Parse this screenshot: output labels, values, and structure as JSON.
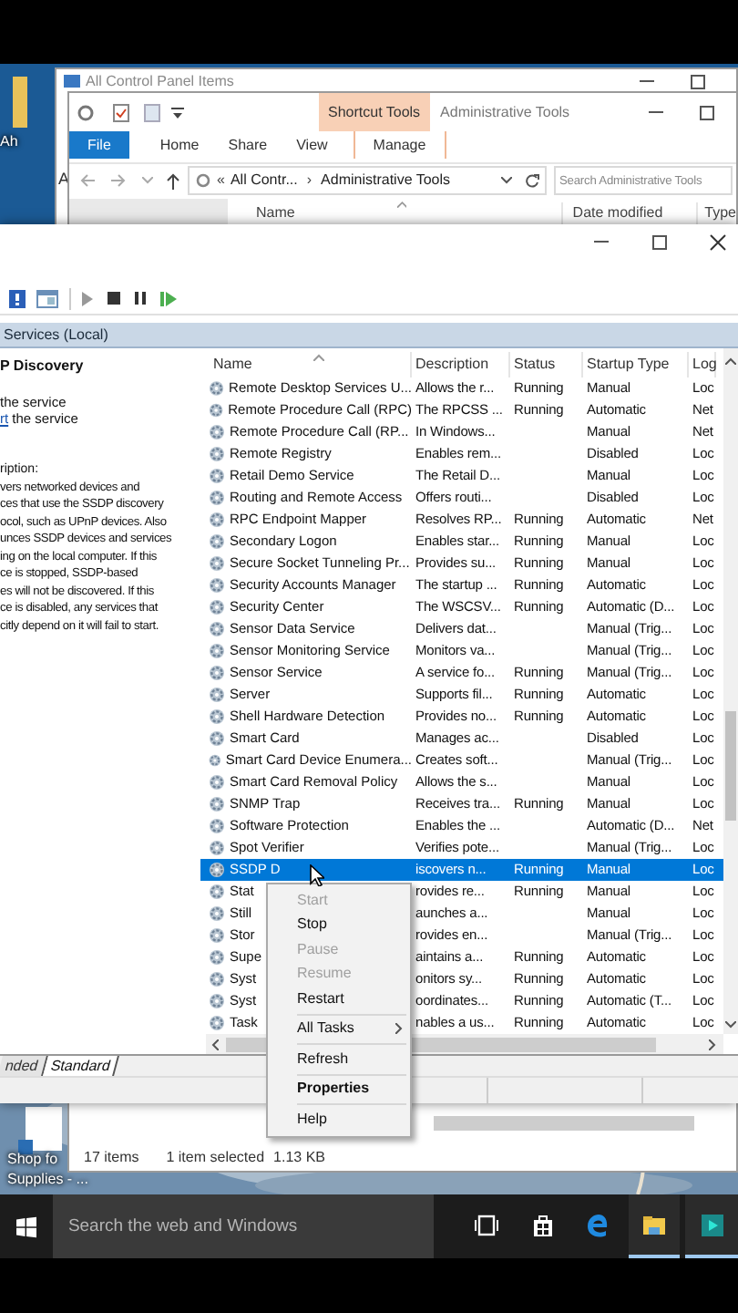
{
  "desktop": {
    "icons": [
      {
        "kind": "folder",
        "lines": [
          "Ah"
        ]
      },
      {
        "kind": "document",
        "lines": [
          "Shop fo",
          "Supplies - ..."
        ]
      }
    ]
  },
  "control_panel_window": {
    "title": "All Control Panel Items",
    "fragment": "A"
  },
  "explorer_window": {
    "contextual_tab": "Shortcut Tools",
    "title": "Administrative Tools",
    "ribbon_tabs": [
      {
        "kind": "file",
        "label": "File"
      },
      {
        "kind": "tab",
        "label": "Home"
      },
      {
        "kind": "tab",
        "label": "Share"
      },
      {
        "kind": "tab",
        "label": "View"
      },
      {
        "kind": "contextual",
        "label": "Manage"
      }
    ],
    "address": {
      "prefix": "«",
      "parent": "All Contr...",
      "separator": "›",
      "current": "Administrative Tools"
    },
    "search": {
      "placeholder": "Search Administrative Tools"
    },
    "columns": [
      "Name",
      "Date modified",
      "Type"
    ],
    "status": {
      "count": "17 items",
      "selection": "1 item selected",
      "size": "1.13 KB"
    }
  },
  "services_window": {
    "scope": "Services (Local)",
    "detail": {
      "title": "P Discovery",
      "actions": [
        {
          "text": "the service"
        },
        {
          "link": "rt",
          "text": "the service"
        }
      ],
      "description_label": "ription:",
      "description_lines": [
        "vers networked devices and",
        "ces that use the SSDP discovery",
        "ocol, such as UPnP devices. Also",
        "unces SSDP devices and services",
        "ing on the local computer. If this",
        "ce is stopped, SSDP-based",
        "es will not be discovered. If this",
        "ce is disabled, any services that",
        "citly depend on it will fail to start."
      ]
    },
    "columns": [
      "Name",
      "Description",
      "Status",
      "Startup Type",
      "Log"
    ],
    "rows": [
      {
        "name": "Remote Desktop Services U...",
        "description": "Allows the r...",
        "status": "Running",
        "startup": "Manual",
        "log": "Loc",
        "selected": false
      },
      {
        "name": "Remote Procedure Call (RPC)",
        "description": "The RPCSS ...",
        "status": "Running",
        "startup": "Automatic",
        "log": "Net",
        "selected": false
      },
      {
        "name": "Remote Procedure Call (RP...",
        "description": "In Windows...",
        "startup": "Manual",
        "log": "Net",
        "selected": false
      },
      {
        "name": "Remote Registry",
        "description": "Enables rem...",
        "startup": "Disabled",
        "log": "Loc",
        "selected": false
      },
      {
        "name": "Retail Demo Service",
        "description": "The Retail D...",
        "startup": "Manual",
        "log": "Loc",
        "selected": false
      },
      {
        "name": "Routing and Remote Access",
        "description": "Offers routi...",
        "startup": "Disabled",
        "log": "Loc",
        "selected": false
      },
      {
        "name": "RPC Endpoint Mapper",
        "description": "Resolves RP...",
        "status": "Running",
        "startup": "Automatic",
        "log": "Net",
        "selected": false
      },
      {
        "name": "Secondary Logon",
        "description": "Enables star...",
        "status": "Running",
        "startup": "Manual",
        "log": "Loc",
        "selected": false
      },
      {
        "name": "Secure Socket Tunneling Pr...",
        "description": "Provides su...",
        "status": "Running",
        "startup": "Manual",
        "log": "Loc",
        "selected": false
      },
      {
        "name": "Security Accounts Manager",
        "description": "The startup ...",
        "status": "Running",
        "startup": "Automatic",
        "log": "Loc",
        "selected": false
      },
      {
        "name": "Security Center",
        "description": "The WSCSV...",
        "status": "Running",
        "startup": "Automatic (D...",
        "log": "Loc",
        "selected": false
      },
      {
        "name": "Sensor Data Service",
        "description": "Delivers dat...",
        "startup": "Manual (Trig...",
        "log": "Loc",
        "selected": false
      },
      {
        "name": "Sensor Monitoring Service",
        "description": "Monitors va...",
        "startup": "Manual (Trig...",
        "log": "Loc",
        "selected": false
      },
      {
        "name": "Sensor Service",
        "description": "A service fo...",
        "status": "Running",
        "startup": "Manual (Trig...",
        "log": "Loc",
        "selected": false
      },
      {
        "name": "Server",
        "description": "Supports fil...",
        "status": "Running",
        "startup": "Automatic",
        "log": "Loc",
        "selected": false
      },
      {
        "name": "Shell Hardware Detection",
        "description": "Provides no...",
        "status": "Running",
        "startup": "Automatic",
        "log": "Loc",
        "selected": false
      },
      {
        "name": "Smart Card",
        "description": "Manages ac...",
        "startup": "Disabled",
        "log": "Loc",
        "selected": false
      },
      {
        "name": "Smart Card Device Enumera...",
        "description": "Creates soft...",
        "startup": "Manual (Trig...",
        "log": "Loc",
        "selected": false
      },
      {
        "name": "Smart Card Removal Policy",
        "description": "Allows the s...",
        "startup": "Manual",
        "log": "Loc",
        "selected": false
      },
      {
        "name": "SNMP Trap",
        "description": "Receives tra...",
        "status": "Running",
        "startup": "Manual",
        "log": "Loc",
        "selected": false
      },
      {
        "name": "Software Protection",
        "description": "Enables the ...",
        "startup": "Automatic (D...",
        "log": "Net",
        "selected": false
      },
      {
        "name": "Spot Verifier",
        "description": "Verifies pote...",
        "startup": "Manual (Trig...",
        "log": "Loc",
        "selected": false
      },
      {
        "name": "SSDP D",
        "description": "iscovers n...",
        "status": "Running",
        "startup": "Manual",
        "log": "Loc",
        "selected": true
      },
      {
        "name": "Stat",
        "description": "rovides re...",
        "status": "Running",
        "startup": "Manual",
        "log": "Loc",
        "selected": false
      },
      {
        "name": "Still",
        "description": "aunches a...",
        "startup": "Manual",
        "log": "Loc",
        "selected": false
      },
      {
        "name": "Stor",
        "description": "rovides en...",
        "startup": "Manual (Trig...",
        "log": "Loc",
        "selected": false
      },
      {
        "name": "Supe",
        "description": "aintains a...",
        "status": "Running",
        "startup": "Automatic",
        "log": "Loc",
        "selected": false
      },
      {
        "name": "Syst",
        "description": "onitors sy...",
        "status": "Running",
        "startup": "Automatic",
        "log": "Loc",
        "selected": false
      },
      {
        "name": "Syst",
        "description": "oordinates...",
        "status": "Running",
        "startup": "Automatic (T...",
        "log": "Loc",
        "selected": false
      },
      {
        "name": "Task",
        "description": "nables a us...",
        "status": "Running",
        "startup": "Automatic",
        "log": "Loc",
        "selected": false
      }
    ],
    "view_tabs": [
      {
        "label": "nded",
        "selected": false
      },
      {
        "label": "Standard",
        "selected": true
      }
    ]
  },
  "context_menu": [
    {
      "kind": "item",
      "label": "Start",
      "disabled": true,
      "default": false
    },
    {
      "kind": "item",
      "label": "Stop",
      "disabled": false,
      "default": false
    },
    {
      "kind": "item",
      "label": "Pause",
      "disabled": true,
      "default": false
    },
    {
      "kind": "item",
      "label": "Resume",
      "disabled": true,
      "default": false
    },
    {
      "kind": "item",
      "label": "Restart",
      "disabled": false,
      "default": false
    },
    {
      "kind": "separator"
    },
    {
      "kind": "submenu",
      "label": "All Tasks",
      "disabled": false,
      "default": false
    },
    {
      "kind": "separator"
    },
    {
      "kind": "item",
      "label": "Refresh",
      "disabled": false,
      "default": false
    },
    {
      "kind": "separator"
    },
    {
      "kind": "item",
      "label": "Properties",
      "disabled": false,
      "default": true
    },
    {
      "kind": "separator"
    },
    {
      "kind": "item",
      "label": "Help",
      "disabled": false,
      "default": false
    }
  ],
  "taskbar": {
    "search": {
      "placeholder": "Search the web and Windows"
    },
    "apps": [
      {
        "kind": "task-view",
        "running": false
      },
      {
        "kind": "store",
        "running": false
      },
      {
        "kind": "edge",
        "running": false
      },
      {
        "kind": "explorer",
        "running": true
      },
      {
        "kind": "media",
        "running": true
      }
    ]
  }
}
